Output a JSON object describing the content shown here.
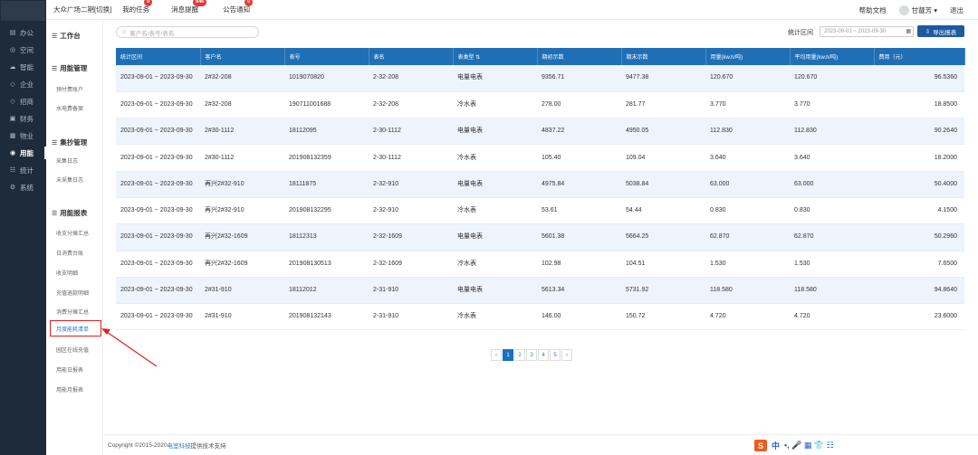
{
  "rail": {
    "items": [
      {
        "icon": "▤",
        "label": "办公"
      },
      {
        "icon": "◎",
        "label": "空间"
      },
      {
        "icon": "☁",
        "label": "智能"
      },
      {
        "icon": "◇",
        "label": "企业"
      },
      {
        "icon": "◇",
        "label": "招商"
      },
      {
        "icon": "▣",
        "label": "财务"
      },
      {
        "icon": "▦",
        "label": "物业"
      },
      {
        "icon": "◉",
        "label": "用能"
      },
      {
        "icon": "☷",
        "label": "统计"
      },
      {
        "icon": "⚙",
        "label": "系统"
      }
    ],
    "active_index": 7
  },
  "header": {
    "project": "大众广场二期[切换]",
    "tasks_label": "我的任务",
    "tasks_badge": "0",
    "msg_label": "消息提醒",
    "msg_badge": "846",
    "notice_label": "公告通知",
    "notice_badge": "0",
    "help": "帮助文档",
    "user": "甘靓芳 ▾",
    "logout": "退出"
  },
  "sidebar": {
    "workbench": "工作台",
    "groups": [
      {
        "title": "用能管理",
        "items": [
          "预付费账户",
          "水电费备案"
        ]
      },
      {
        "title": "集抄管理",
        "items": [
          "采集日志",
          "未采集日志"
        ]
      },
      {
        "title": "用能报表",
        "items": [
          "收支分摊汇总",
          "日消费台账",
          "收支明细",
          "充值退款明细",
          "消费分摊汇总",
          "月度能耗清单",
          "园区在线充值",
          "用能日报表",
          "用能月报表"
        ]
      }
    ],
    "highlighted": "月度能耗清单"
  },
  "toolbar": {
    "search_placeholder": "客户名/表号/表名",
    "range_label": "统计区间",
    "range_value": "2023-09-01 ~ 2023-09-30",
    "export_label": "导出报表"
  },
  "table": {
    "headers": [
      "统计区间",
      "客户名",
      "表号",
      "表名",
      "表类型 ⇅",
      "期初示数",
      "期末示数",
      "用量(kw.h/吨)",
      "平均用量(kw.h/吨)",
      "费用（元）"
    ],
    "rows": [
      [
        "2023-09-01 ~ 2023-09-30",
        "2#32-208",
        "1019070820",
        "2-32-208",
        "电量电表",
        "9356.71",
        "9477.38",
        "120.670",
        "120.670",
        "96.5360"
      ],
      [
        "2023-09-01 ~ 2023-09-30",
        "2#32-208",
        "190711001688",
        "2-32-208",
        "冷水表",
        "278.00",
        "281.77",
        "3.770",
        "3.770",
        "18.8500"
      ],
      [
        "2023-09-01 ~ 2023-09-30",
        "2#30-1112",
        "18112095",
        "2-30-1112",
        "电量电表",
        "4837.22",
        "4950.05",
        "112.830",
        "112.830",
        "90.2640"
      ],
      [
        "2023-09-01 ~ 2023-09-30",
        "2#30-1112",
        "201908132359",
        "2-30-1112",
        "冷水表",
        "105.40",
        "109.04",
        "3.640",
        "3.640",
        "18.2000"
      ],
      [
        "2023-09-01 ~ 2023-09-30",
        "再兴2#32-910",
        "18111875",
        "2-32-910",
        "电量电表",
        "4975.84",
        "5038.84",
        "63.000",
        "63.000",
        "50.4000"
      ],
      [
        "2023-09-01 ~ 2023-09-30",
        "再兴2#32-910",
        "201908132295",
        "2-32-910",
        "冷水表",
        "53.61",
        "54.44",
        "0.830",
        "0.830",
        "4.1500"
      ],
      [
        "2023-09-01 ~ 2023-09-30",
        "再兴2#32-1609",
        "18112313",
        "2-32-1609",
        "电量电表",
        "5601.38",
        "5664.25",
        "62.870",
        "62.870",
        "50.2960"
      ],
      [
        "2023-09-01 ~ 2023-09-30",
        "再兴2#32-1609",
        "201908130513",
        "2-32-1609",
        "冷水表",
        "102.98",
        "104.51",
        "1.530",
        "1.530",
        "7.6500"
      ],
      [
        "2023-09-01 ~ 2023-09-30",
        "2#31-910",
        "18112012",
        "2-31-910",
        "电量电表",
        "5613.34",
        "5731.92",
        "118.580",
        "118.580",
        "94.8640"
      ],
      [
        "2023-09-01 ~ 2023-09-30",
        "2#31-910",
        "201908132143",
        "2-31-910",
        "冷水表",
        "146.00",
        "150.72",
        "4.720",
        "4.720",
        "23.6000"
      ]
    ]
  },
  "pager": {
    "prev": "«",
    "pages": [
      "1",
      "2",
      "3",
      "4",
      "5"
    ],
    "next": "»",
    "current": "1"
  },
  "footer": {
    "prefix": "Copyright ©2015-2020 ",
    "brand": "电室科技",
    "suffix": " 提供技术支持"
  },
  "ime": {
    "logo": "S",
    "lang": "中",
    "glyphs": "•, 🎤 ▦ 👕 ☷"
  },
  "colors": {
    "rail": "#1e2b3a",
    "header_blue": "#1f6fb6",
    "highlight_red": "#e02020",
    "badge": "#e53935"
  }
}
